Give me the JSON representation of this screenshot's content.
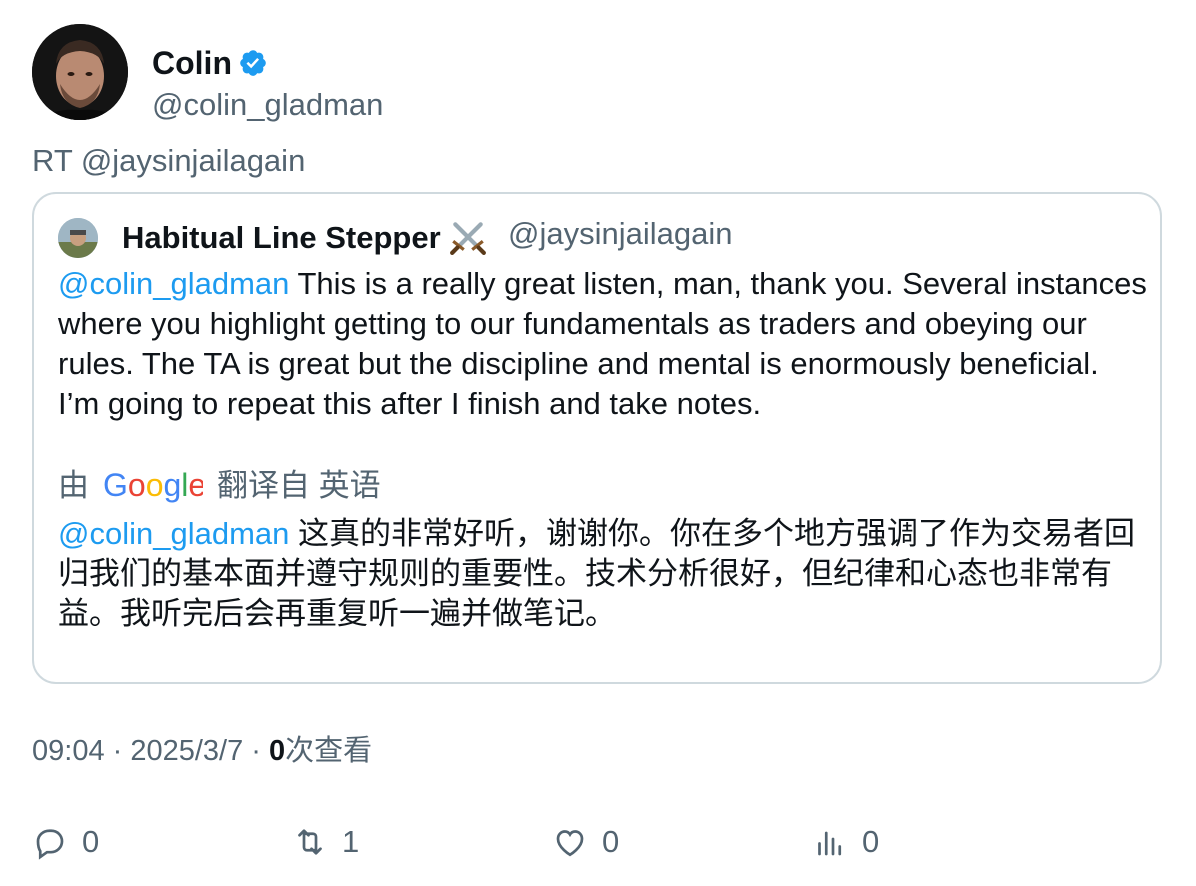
{
  "tweet": {
    "author_name": "Colin",
    "author_handle": "@colin_gladman",
    "rt_prefix": "RT ",
    "rt_handle": "@jaysinjailagain",
    "timestamp": "09:04 · 2025/3/7 · ",
    "views_count": "0",
    "views_label": "次查看"
  },
  "quote": {
    "author_name": "Habitual Line Stepper",
    "author_handle": "@jaysinjailagain",
    "mention": "@colin_gladman",
    "body": " This is a really great listen, man, thank you. Several instances where you highlight getting to our fundamentals as traders and obeying our rules. The TA is great but the discipline and mental is enormously beneficial. I’m going to repeat this after I finish and take notes.",
    "translate_by": "由",
    "translate_from": "翻译自 英语",
    "translated_mention": "@colin_gladman",
    "translated_body": " 这真的非常好听，谢谢你。你在多个地方强调了作为交易者回归我们的基本面并遵守规则的重要性。技术分析很好，但纪律和心态也非常有益。我听完后会再重复听一遍并做笔记。"
  },
  "actions": {
    "replies": "0",
    "retweets": "1",
    "likes": "0",
    "views": "0"
  },
  "colors": {
    "link": "#1d9bf0",
    "verified": "#1d9bf0",
    "secondary_text": "#536471"
  },
  "icons": [
    "verified-badge-icon",
    "crossed-swords-icon",
    "google-logo",
    "reply-icon",
    "retweet-icon",
    "like-icon",
    "views-icon"
  ]
}
